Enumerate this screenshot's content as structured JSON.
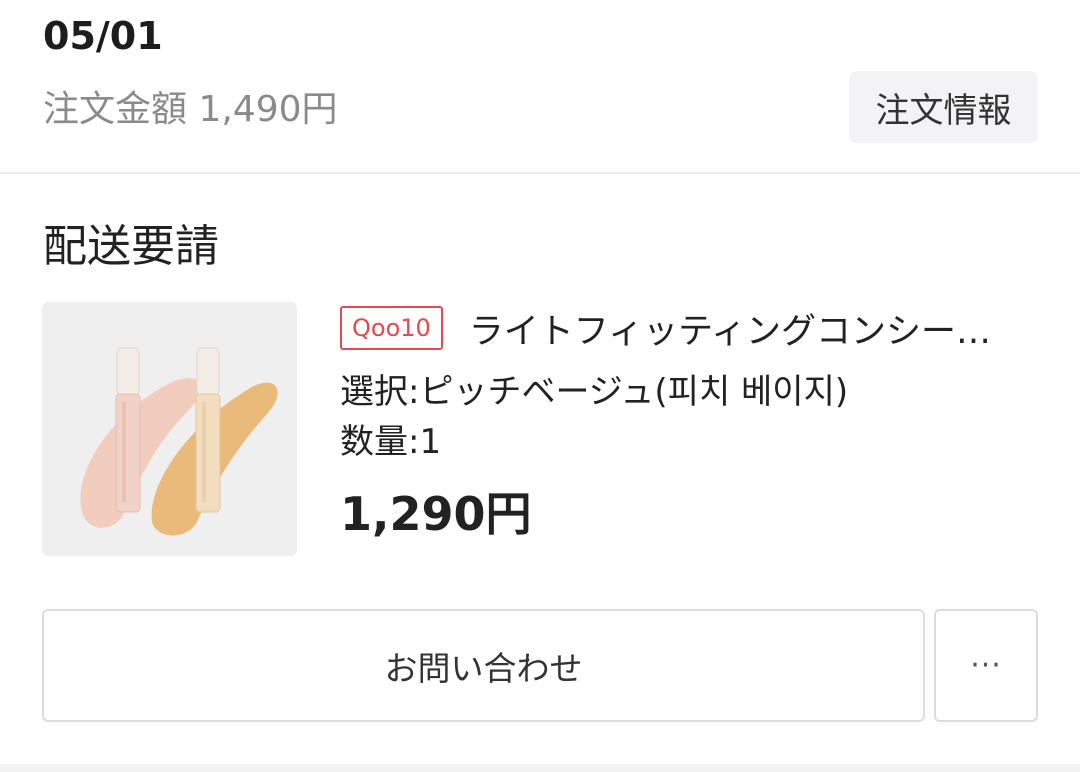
{
  "order": {
    "date": "05/01",
    "amount_text": "注文金額 1,490円",
    "info_button_label": "注文情報"
  },
  "status": {
    "title": "配送要請"
  },
  "product": {
    "badge": "Qoo10",
    "name": "ライトフィッティングコンシー…",
    "option": "選択:ピッチベージュ(피치 베이지)",
    "quantity": "数量:1",
    "price": "1,290円",
    "image_icon": "concealer-product-image"
  },
  "actions": {
    "inquiry_label": "お問い合わせ",
    "more_label": "···"
  },
  "colors": {
    "badge_red": "#e8484f",
    "secondary_text": "#8a8a8a",
    "button_bg": "#f3f3f5",
    "border": "#dcdcdc"
  }
}
